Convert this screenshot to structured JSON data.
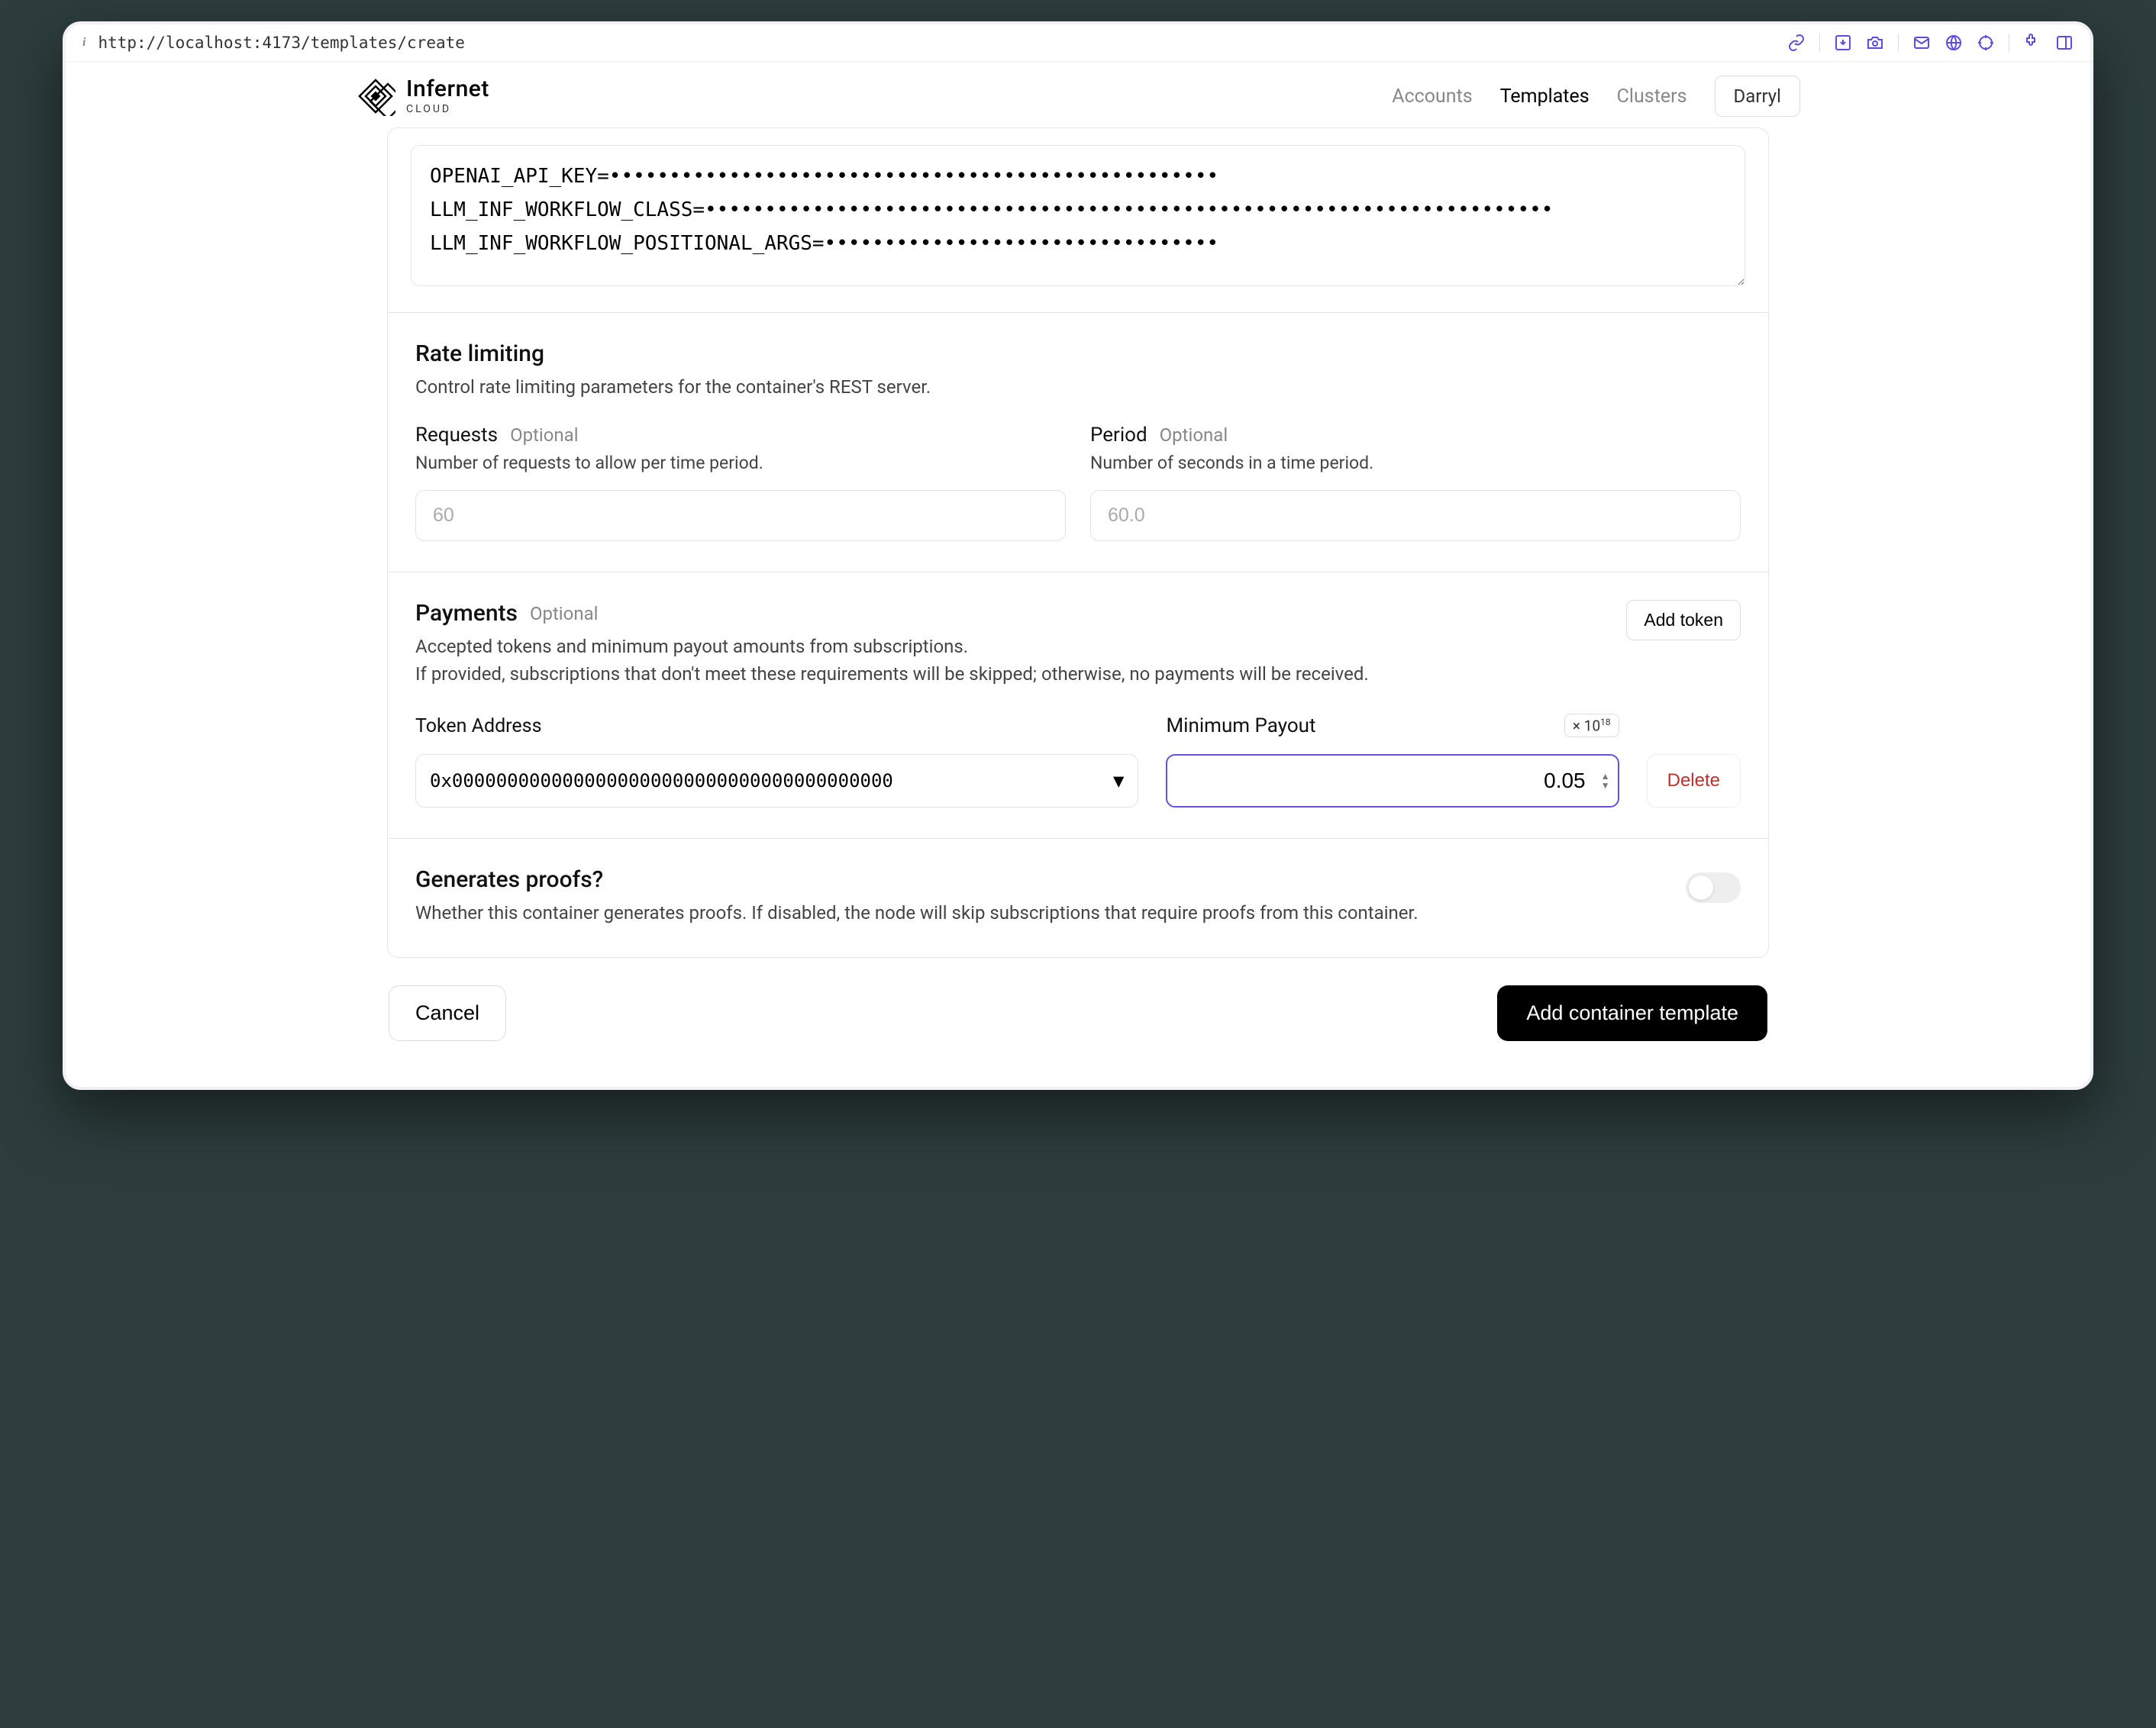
{
  "browser": {
    "url": "http://localhost:4173/templates/create"
  },
  "brand": {
    "name": "Infernet",
    "sub": "CLOUD"
  },
  "nav": {
    "accounts": "Accounts",
    "templates": "Templates",
    "clusters": "Clusters",
    "user": "Darryl"
  },
  "env": {
    "textarea_value": "OPENAI_API_KEY=•••••••••••••••••••••••••••••••••••••••••••••••••••\nLLM_INF_WORKFLOW_CLASS=•••••••••••••••••••••••••••••••••••••••••••••••••••••••••••••••••••••••\nLLM_INF_WORKFLOW_POSITIONAL_ARGS=•••••••••••••••••••••••••••••••••"
  },
  "rate_limiting": {
    "title": "Rate limiting",
    "desc": "Control rate limiting parameters for the container's REST server.",
    "requests": {
      "label": "Requests",
      "optional": "Optional",
      "sub": "Number of requests to allow per time period.",
      "placeholder": "60"
    },
    "period": {
      "label": "Period",
      "optional": "Optional",
      "sub": "Number of seconds in a time period.",
      "placeholder": "60.0"
    }
  },
  "payments": {
    "title": "Payments",
    "optional": "Optional",
    "add_token": "Add token",
    "desc1": "Accepted tokens and minimum payout amounts from subscriptions.",
    "desc2": "If provided, subscriptions that don't meet these requirements will be skipped; otherwise, no payments will be received.",
    "token_label": "Token Address",
    "token_value": "0x0000000000000000000000000000000000000000",
    "payout_label": "Minimum Payout",
    "payout_badge_prefix": "× 10",
    "payout_badge_exp": "18",
    "payout_value": "0.05",
    "delete_label": "Delete"
  },
  "proofs": {
    "title": "Generates proofs?",
    "desc": "Whether this container generates proofs. If disabled, the node will skip subscriptions that require proofs from this container."
  },
  "footer": {
    "cancel": "Cancel",
    "submit": "Add container template"
  }
}
